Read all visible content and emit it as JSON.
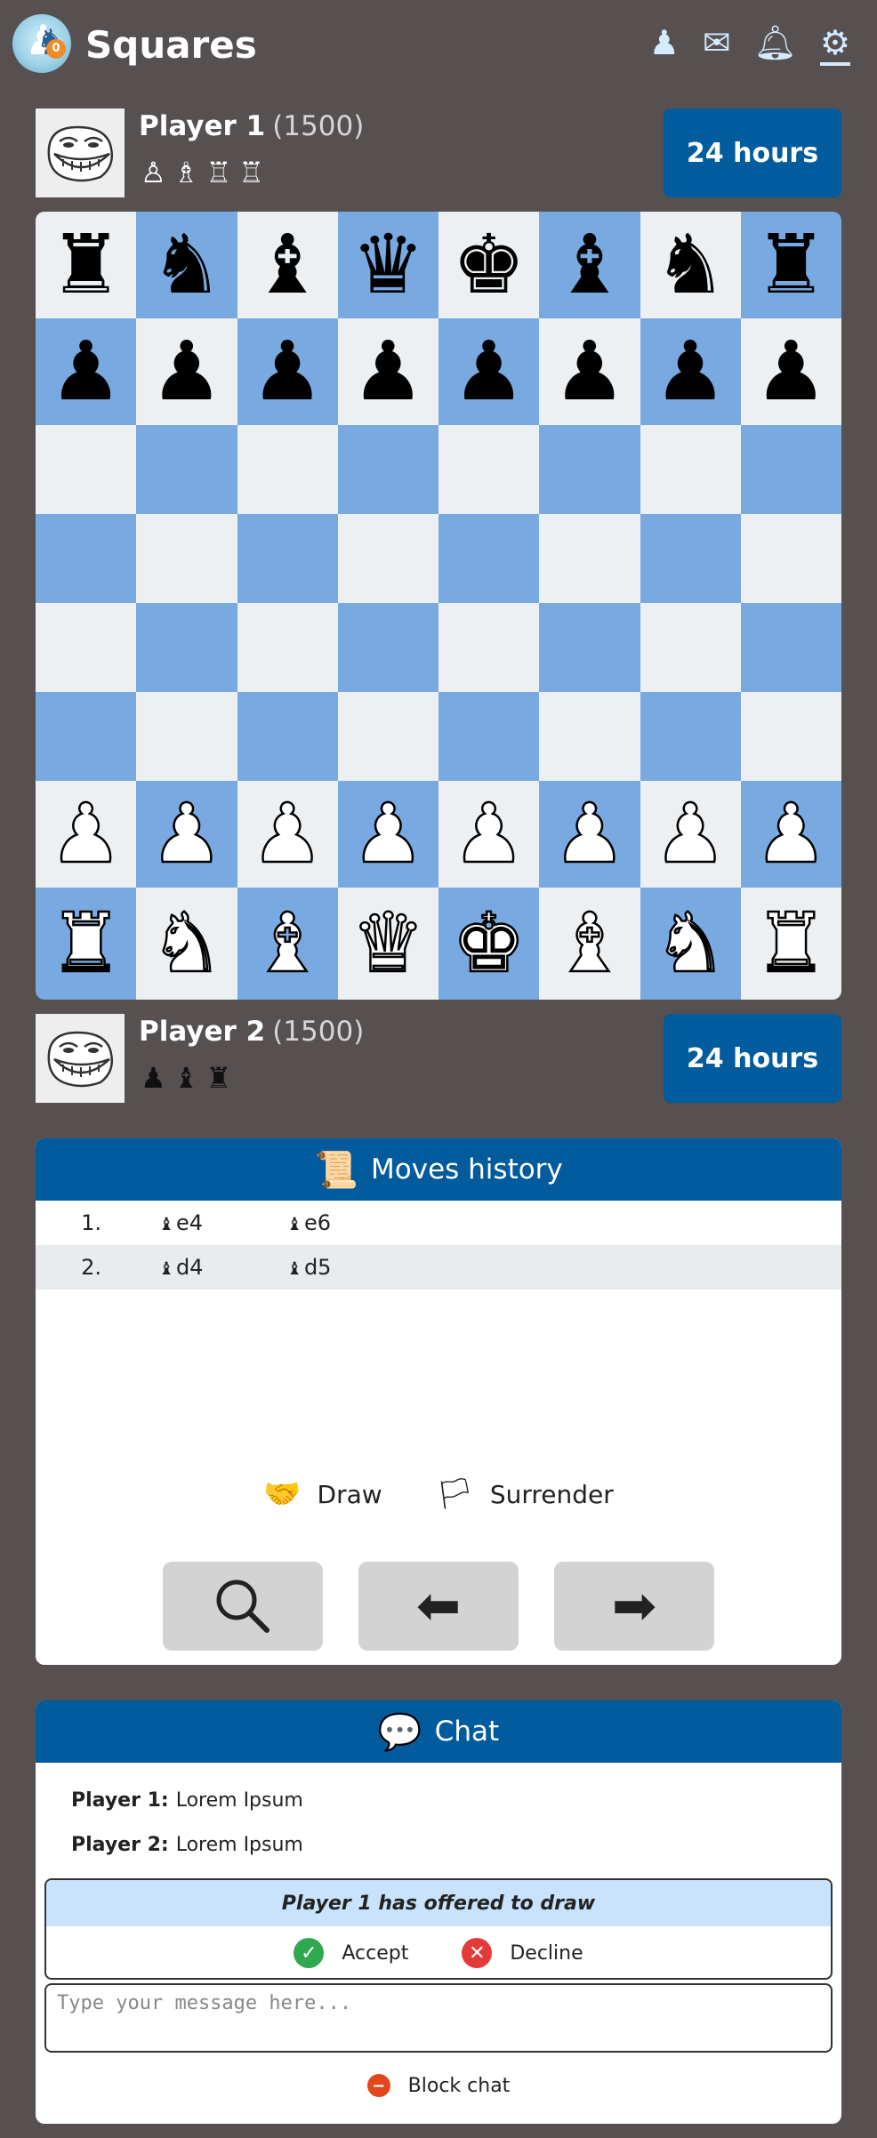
{
  "app": {
    "title": "Squares"
  },
  "header_icons": [
    "pawn-icon",
    "mail-icon",
    "bell-icon",
    "settings-icon"
  ],
  "players": {
    "top": {
      "name": "Player 1",
      "rating": "(1500)",
      "timer": "24 hours",
      "captured": [
        "♙",
        "♗",
        "♖",
        "♖"
      ]
    },
    "bottom": {
      "name": "Player 2",
      "rating": "(1500)",
      "timer": "24 hours",
      "captured": [
        "♟",
        "♝",
        "♜"
      ]
    }
  },
  "board": [
    [
      "♜",
      "♞",
      "♝",
      "♛",
      "♚",
      "♝",
      "♞",
      "♜"
    ],
    [
      "♟",
      "♟",
      "♟",
      "♟",
      "♟",
      "♟",
      "♟",
      "♟"
    ],
    [
      "",
      "",
      "",
      "",
      "",
      "",
      "",
      ""
    ],
    [
      "",
      "",
      "",
      "",
      "",
      "",
      "",
      ""
    ],
    [
      "",
      "",
      "",
      "",
      "",
      "",
      "",
      ""
    ],
    [
      "",
      "",
      "",
      "",
      "",
      "",
      "",
      ""
    ],
    [
      "♙",
      "♙",
      "♙",
      "♙",
      "♙",
      "♙",
      "♙",
      "♙"
    ],
    [
      "♖",
      "♘",
      "♗",
      "♕",
      "♔",
      "♗",
      "♘",
      "♖"
    ]
  ],
  "moves": {
    "title": "Moves history",
    "rows": [
      {
        "num": "1.",
        "white": "e4",
        "black": "e6"
      },
      {
        "num": "2.",
        "white": "d4",
        "black": "d5"
      }
    ],
    "draw_label": "Draw",
    "surrender_label": "Surrender"
  },
  "chat": {
    "title": "Chat",
    "messages": [
      {
        "author": "Player 1:",
        "text": "Lorem Ipsum"
      },
      {
        "author": "Player 2:",
        "text": "Lorem Ipsum"
      }
    ],
    "draw_offer": "Player 1 has offered to draw",
    "accept_label": "Accept",
    "decline_label": "Decline",
    "input_placeholder": "Type your message here...",
    "block_label": "Block chat"
  }
}
